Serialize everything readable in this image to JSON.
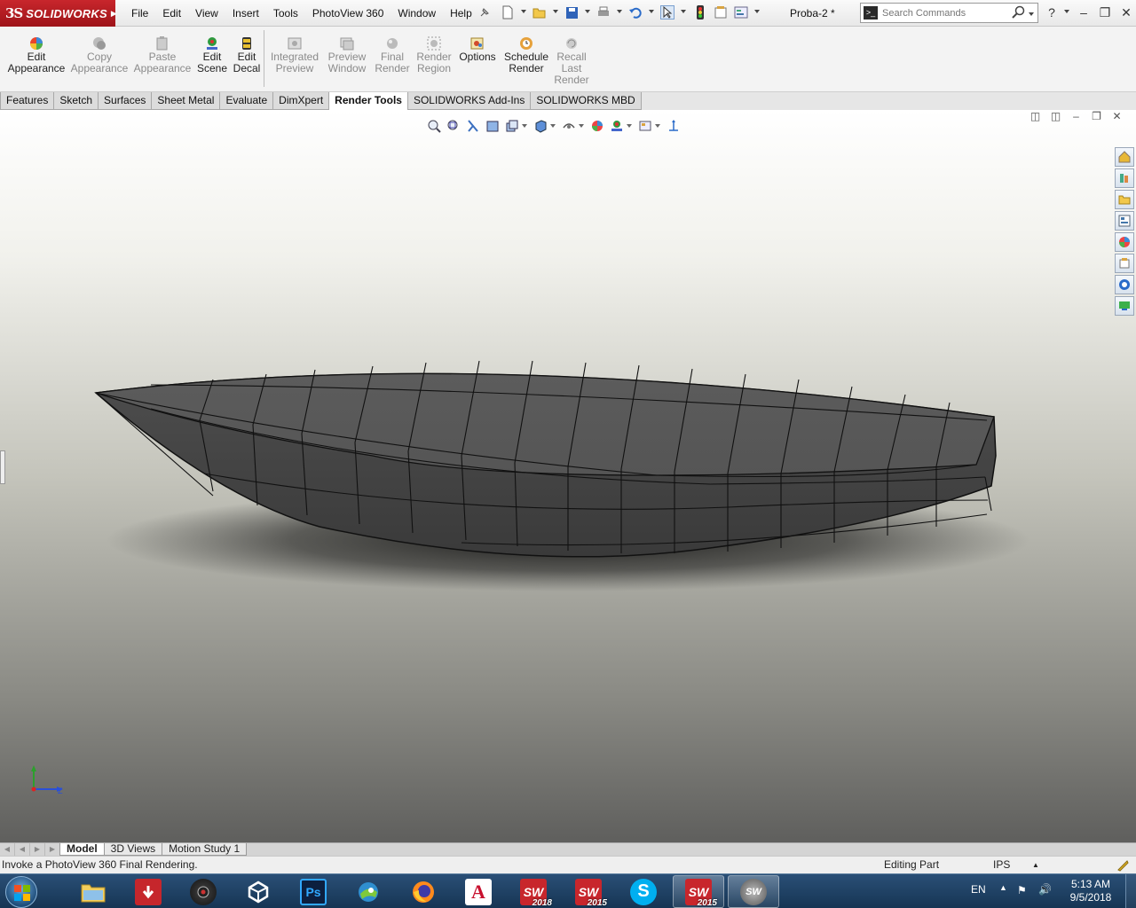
{
  "app": {
    "logo_mark": "3S",
    "logo_name": "SOLIDWORKS",
    "document_title": "Proba-2 *"
  },
  "menu": [
    "File",
    "Edit",
    "View",
    "Insert",
    "Tools",
    "PhotoView 360",
    "Window",
    "Help"
  ],
  "search": {
    "placeholder": "Search Commands"
  },
  "ribbon": {
    "buttons": [
      {
        "line1": "Edit",
        "line2": "Appearance",
        "line3": "",
        "enabled": true,
        "icon": "appearance-icon"
      },
      {
        "line1": "Copy",
        "line2": "Appearance",
        "line3": "",
        "enabled": false,
        "icon": "copy-appearance-icon"
      },
      {
        "line1": "Paste",
        "line2": "Appearance",
        "line3": "",
        "enabled": false,
        "icon": "paste-appearance-icon"
      },
      {
        "line1": "Edit",
        "line2": "Scene",
        "line3": "",
        "enabled": true,
        "icon": "scene-icon"
      },
      {
        "line1": "Edit",
        "line2": "Decal",
        "line3": "",
        "enabled": true,
        "icon": "decal-icon"
      },
      {
        "line1": "Integrated",
        "line2": "Preview",
        "line3": "",
        "enabled": false,
        "icon": "integrated-preview-icon"
      },
      {
        "line1": "Preview",
        "line2": "Window",
        "line3": "",
        "enabled": false,
        "icon": "preview-window-icon"
      },
      {
        "line1": "Final",
        "line2": "Render",
        "line3": "",
        "enabled": false,
        "icon": "final-render-icon"
      },
      {
        "line1": "Render",
        "line2": "Region",
        "line3": "",
        "enabled": false,
        "icon": "render-region-icon"
      },
      {
        "line1": "Options",
        "line2": "",
        "line3": "",
        "enabled": true,
        "icon": "options-icon"
      },
      {
        "line1": "Schedule",
        "line2": "Render",
        "line3": "",
        "enabled": true,
        "icon": "schedule-render-icon"
      },
      {
        "line1": "Recall",
        "line2": "Last",
        "line3": "Render",
        "enabled": false,
        "icon": "recall-render-icon"
      }
    ]
  },
  "tabs": [
    {
      "label": "Features",
      "active": false
    },
    {
      "label": "Sketch",
      "active": false
    },
    {
      "label": "Surfaces",
      "active": false
    },
    {
      "label": "Sheet Metal",
      "active": false
    },
    {
      "label": "Evaluate",
      "active": false
    },
    {
      "label": "DimXpert",
      "active": false
    },
    {
      "label": "Render Tools",
      "active": true
    },
    {
      "label": "SOLIDWORKS Add-Ins",
      "active": false
    },
    {
      "label": "SOLIDWORKS MBD",
      "active": false
    }
  ],
  "colors": {
    "logo_red": "#b01e23",
    "hull_face": "#5a5a5a",
    "hull_edge": "#111111",
    "taskbar": "#1f4266",
    "accent_blue": "#1e6ec8"
  },
  "triad": {
    "x_label": "",
    "z_label": "Z"
  },
  "model_tabs": [
    {
      "label": "Model",
      "active": true
    },
    {
      "label": "3D Views",
      "active": false
    },
    {
      "label": "Motion Study 1",
      "active": false
    }
  ],
  "status": {
    "message": "Invoke a PhotoView 360 Final Rendering.",
    "mode": "Editing Part",
    "units": "IPS"
  },
  "taskbar": {
    "apps": [
      {
        "name": "file-explorer",
        "label": ""
      },
      {
        "name": "download-manager",
        "label": ""
      },
      {
        "name": "camera-app",
        "label": ""
      },
      {
        "name": "unity",
        "label": ""
      },
      {
        "name": "photoshop",
        "label": "Ps"
      },
      {
        "name": "helmet-app",
        "label": ""
      },
      {
        "name": "firefox",
        "label": ""
      },
      {
        "name": "autocad",
        "label": "A"
      },
      {
        "name": "solidworks-2018",
        "label": "SW",
        "version": "2018"
      },
      {
        "name": "solidworks-2015",
        "label": "SW",
        "version": "2015"
      },
      {
        "name": "skype",
        "label": "S"
      },
      {
        "name": "solidworks-2015-running",
        "label": "SW",
        "version": "2015"
      },
      {
        "name": "solidworks-running",
        "label": "SW"
      }
    ],
    "language": "EN",
    "time": "5:13 AM",
    "date": "9/5/2018"
  }
}
